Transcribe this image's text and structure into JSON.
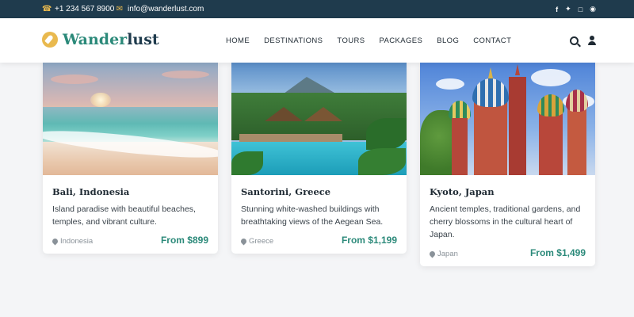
{
  "topbar": {
    "phone": "+1 234 567 8900",
    "email": "info@wanderlust.com",
    "socials": [
      "f",
      "t",
      "ig",
      "p"
    ]
  },
  "nav": {
    "logo_part1": "Wander",
    "logo_part2": "lust",
    "menu": [
      "HOME",
      "DESTINATIONS",
      "TOURS",
      "PACKAGES",
      "BLOG",
      "CONTACT"
    ],
    "icons": [
      "search-icon",
      "user-icon"
    ]
  },
  "colors": {
    "topbar_bg": "#1f3b4d",
    "accent_gold": "#e9b94e",
    "accent_teal": "#2c8a7a"
  },
  "cards": [
    {
      "title": "Bali, Indonesia",
      "description": "Island paradise with beautiful beaches, temples, and vibrant culture.",
      "location": "Indonesia",
      "price": "From $899"
    },
    {
      "title": "Santorini, Greece",
      "description": "Stunning white-washed buildings with breathtaking views of the Aegean Sea.",
      "location": "Greece",
      "price": "From $1,199"
    },
    {
      "title": "Kyoto, Japan",
      "description": "Ancient temples, traditional gardens, and cherry blossoms in the cultural heart of Japan.",
      "location": "Japan",
      "price": "From $1,499"
    }
  ]
}
